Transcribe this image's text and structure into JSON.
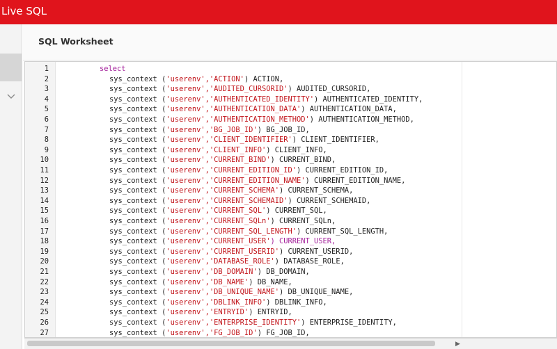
{
  "app": {
    "title": "Live SQL"
  },
  "worksheet": {
    "title": "SQL Worksheet"
  },
  "colors": {
    "brand": "#e0141c",
    "keyword": "#a31f9a",
    "string": "#c2161c"
  },
  "editor": {
    "lines": [
      {
        "n": "1",
        "kw": "select"
      },
      {
        "n": "2",
        "fn": "sys_context (",
        "str": "'userenv','ACTION'",
        "rest": ") ACTION,"
      },
      {
        "n": "3",
        "fn": "sys_context (",
        "str": "'userenv','AUDITED_CURSORID'",
        "rest": ") AUDITED_CURSORID,"
      },
      {
        "n": "4",
        "fn": "sys_context (",
        "str": "'userenv','AUTHENTICATED_IDENTITY'",
        "rest": ") AUTHENTICATED_IDENTITY,"
      },
      {
        "n": "5",
        "fn": "sys_context (",
        "str": "'userenv','AUTHENTICATION_DATA'",
        "rest": ") AUTHENTICATION_DATA,"
      },
      {
        "n": "6",
        "fn": "sys_context (",
        "str": "'userenv','AUTHENTICATION_METHOD'",
        "rest": ") AUTHENTICATION_METHOD,"
      },
      {
        "n": "7",
        "fn": "sys_context (",
        "str": "'userenv','BG_JOB_ID'",
        "rest": ") BG_JOB_ID,"
      },
      {
        "n": "8",
        "fn": "sys_context (",
        "str": "'userenv','CLIENT_IDENTIFIER'",
        "rest": ") CLIENT_IDENTIFIER,"
      },
      {
        "n": "9",
        "fn": "sys_context (",
        "str": "'userenv','CLIENT_INFO'",
        "rest": ") CLIENT_INFO,"
      },
      {
        "n": "10",
        "fn": "sys_context (",
        "str": "'userenv','CURRENT_BIND'",
        "rest": ") CURRENT_BIND,"
      },
      {
        "n": "11",
        "fn": "sys_context (",
        "str": "'userenv','CURRENT_EDITION_ID'",
        "rest": ") CURRENT_EDITION_ID,"
      },
      {
        "n": "12",
        "fn": "sys_context (",
        "str": "'userenv','CURRENT_EDITION_NAME'",
        "rest": ") CURRENT_EDITION_NAME,"
      },
      {
        "n": "13",
        "fn": "sys_context (",
        "str": "'userenv','CURRENT_SCHEMA'",
        "rest": ") CURRENT_SCHEMA,"
      },
      {
        "n": "14",
        "fn": "sys_context (",
        "str": "'userenv','CURRENT_SCHEMAID'",
        "rest": ") CURRENT_SCHEMAID,"
      },
      {
        "n": "15",
        "fn": "sys_context (",
        "str": "'userenv','CURRENT_SQL'",
        "rest": ") CURRENT_SQL,"
      },
      {
        "n": "16",
        "fn": "sys_context (",
        "str": "'userenv','CURRENT_SQLn'",
        "rest": ") CURRENT_SQLn,"
      },
      {
        "n": "17",
        "fn": "sys_context (",
        "str": "'userenv','CURRENT_SQL_LENGTH'",
        "rest": ") CURRENT_SQL_LENGTH,"
      },
      {
        "n": "18",
        "fn": "sys_context (",
        "str": "'userenv','CURRENT_USER'",
        "rest": ") CURRENT_USER,",
        "purple": true
      },
      {
        "n": "19",
        "fn": "sys_context (",
        "str": "'userenv','CURRENT_USERID'",
        "rest": ") CURRENT_USERID,"
      },
      {
        "n": "20",
        "fn": "sys_context (",
        "str": "'userenv','DATABASE_ROLE'",
        "rest": ") DATABASE_ROLE,"
      },
      {
        "n": "21",
        "fn": "sys_context (",
        "str": "'userenv','DB_DOMAIN'",
        "rest": ") DB_DOMAIN,"
      },
      {
        "n": "22",
        "fn": "sys_context (",
        "str": "'userenv','DB_NAME'",
        "rest": ") DB_NAME,"
      },
      {
        "n": "23",
        "fn": "sys_context (",
        "str": "'userenv','DB_UNIQUE_NAME'",
        "rest": ") DB_UNIQUE_NAME,"
      },
      {
        "n": "24",
        "fn": "sys_context (",
        "str": "'userenv','DBLINK_INFO'",
        "rest": ") DBLINK_INFO,"
      },
      {
        "n": "25",
        "fn": "sys_context (",
        "str": "'userenv','ENTRYID'",
        "rest": ") ENTRYID,"
      },
      {
        "n": "26",
        "fn": "sys_context (",
        "str": "'userenv','ENTERPRISE_IDENTITY'",
        "rest": ") ENTERPRISE_IDENTITY,"
      },
      {
        "n": "27",
        "fn": "sys_context (",
        "str": "'userenv','FG_JOB_ID'",
        "rest": ") FG_JOB_ID,"
      }
    ]
  },
  "icons": {
    "expand": "chevron-down-icon",
    "scroll_right": "scroll-right-arrow-icon"
  }
}
